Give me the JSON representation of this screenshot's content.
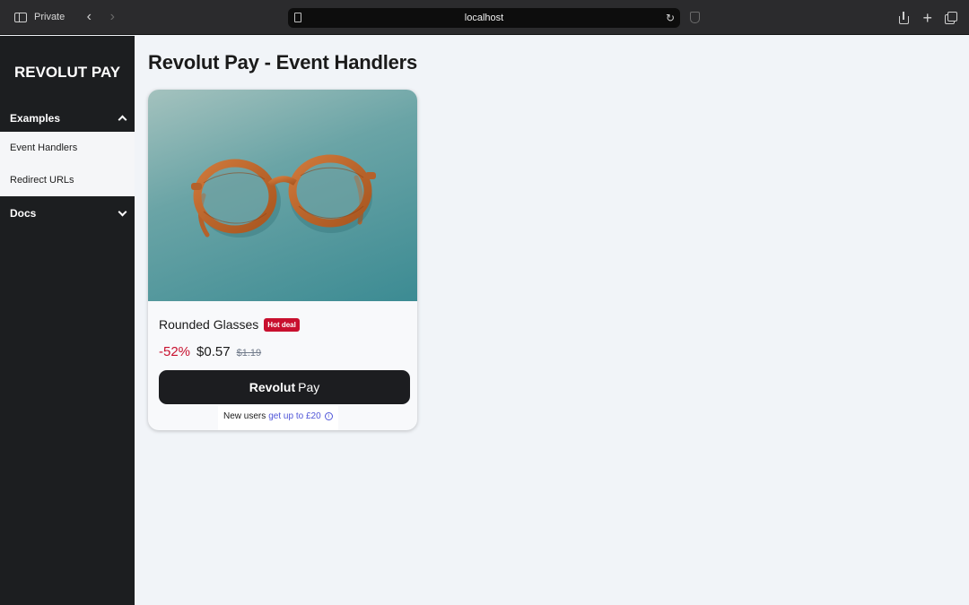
{
  "browser": {
    "private_label": "Private",
    "back_glyph": "‹",
    "forward_glyph": "›",
    "url": "localhost",
    "reload_glyph": "↻",
    "plus_glyph": "+"
  },
  "sidebar": {
    "brand": "REVOLUT PAY",
    "groups": [
      {
        "label": "Examples",
        "expanded": true,
        "items": [
          {
            "label": "Event Handlers"
          },
          {
            "label": "Redirect URLs"
          }
        ]
      },
      {
        "label": "Docs",
        "expanded": false
      }
    ]
  },
  "main": {
    "title": "Revolut Pay - Event Handlers",
    "product": {
      "image_icon": "glasses-image",
      "name": "Rounded Glasses",
      "badge": "Hot deal",
      "discount": "-52%",
      "price": "$0.57",
      "old_price": "$1.19",
      "pay_brand": "Revolut",
      "pay_word": "Pay",
      "promo_text": "New users",
      "promo_link": "get up to £20",
      "info_glyph": "i"
    }
  },
  "colors": {
    "accent": "#c8102e",
    "link": "#4f55d8",
    "sidebar_bg": "#1c1e20",
    "page_bg": "#f1f4f8"
  }
}
